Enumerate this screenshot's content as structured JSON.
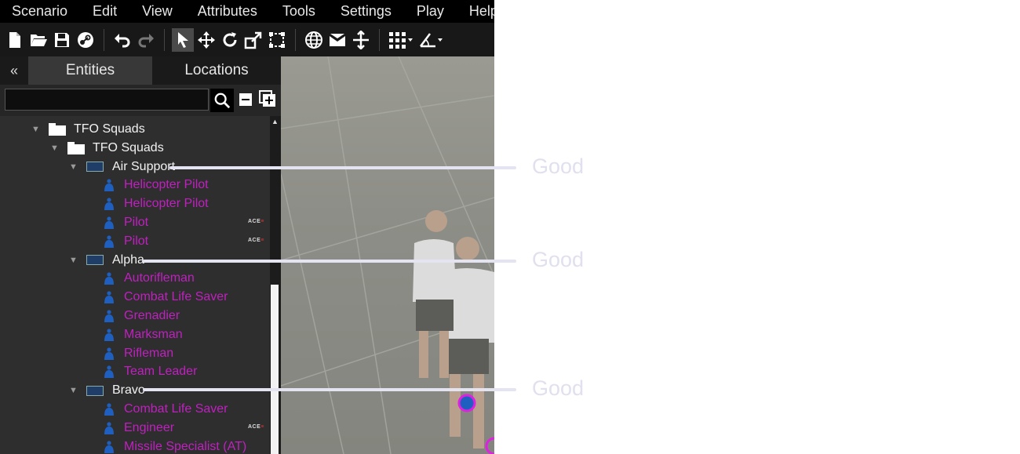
{
  "menu": [
    "Scenario",
    "Edit",
    "View",
    "Attributes",
    "Tools",
    "Settings",
    "Play",
    "Help"
  ],
  "toolbar": {
    "icons": [
      "new-file-icon",
      "open-folder-icon",
      "save-icon",
      "steam-icon",
      "undo-icon",
      "redo-icon",
      "select-cursor-icon",
      "move-icon",
      "rotate-icon",
      "scale-icon",
      "transform-box-icon",
      "globe-icon",
      "mail-icon",
      "vertical-snap-icon",
      "grid-icon",
      "angle-icon"
    ]
  },
  "panel": {
    "collapse_glyph": "«",
    "tabs": [
      {
        "label": "Entities"
      },
      {
        "label": "Locations"
      }
    ],
    "search": {
      "value": "",
      "placeholder": ""
    }
  },
  "tree": [
    {
      "kind": "folder",
      "label": "TFO Squads"
    },
    {
      "kind": "folder",
      "label": "TFO Squads"
    },
    {
      "kind": "group",
      "label": "Air Support"
    },
    {
      "kind": "unit",
      "label": "Helicopter Pilot"
    },
    {
      "kind": "unit",
      "label": "Helicopter Pilot"
    },
    {
      "kind": "unit",
      "label": "Pilot",
      "badge": "ACE"
    },
    {
      "kind": "unit",
      "label": "Pilot",
      "badge": "ACE"
    },
    {
      "kind": "group",
      "label": "Alpha"
    },
    {
      "kind": "unit",
      "label": "Autorifleman"
    },
    {
      "kind": "unit",
      "label": "Combat Life Saver"
    },
    {
      "kind": "unit",
      "label": "Grenadier"
    },
    {
      "kind": "unit",
      "label": "Marksman"
    },
    {
      "kind": "unit",
      "label": "Rifleman"
    },
    {
      "kind": "unit",
      "label": "Team Leader"
    },
    {
      "kind": "group",
      "label": "Bravo"
    },
    {
      "kind": "unit",
      "label": "Combat Life Saver"
    },
    {
      "kind": "unit",
      "label": "Engineer",
      "badge": "ACE"
    },
    {
      "kind": "unit",
      "label": "Missile Specialist (AT)"
    }
  ],
  "annotations": [
    {
      "text": "Good",
      "target": "Air Support"
    },
    {
      "text": "Good",
      "target": "Alpha"
    },
    {
      "text": "Good",
      "target": "Bravo"
    }
  ],
  "colors": {
    "unit_text": "#c020c0",
    "unit_icon": "#1f5fbf",
    "annotation": "#e3e3f2"
  }
}
